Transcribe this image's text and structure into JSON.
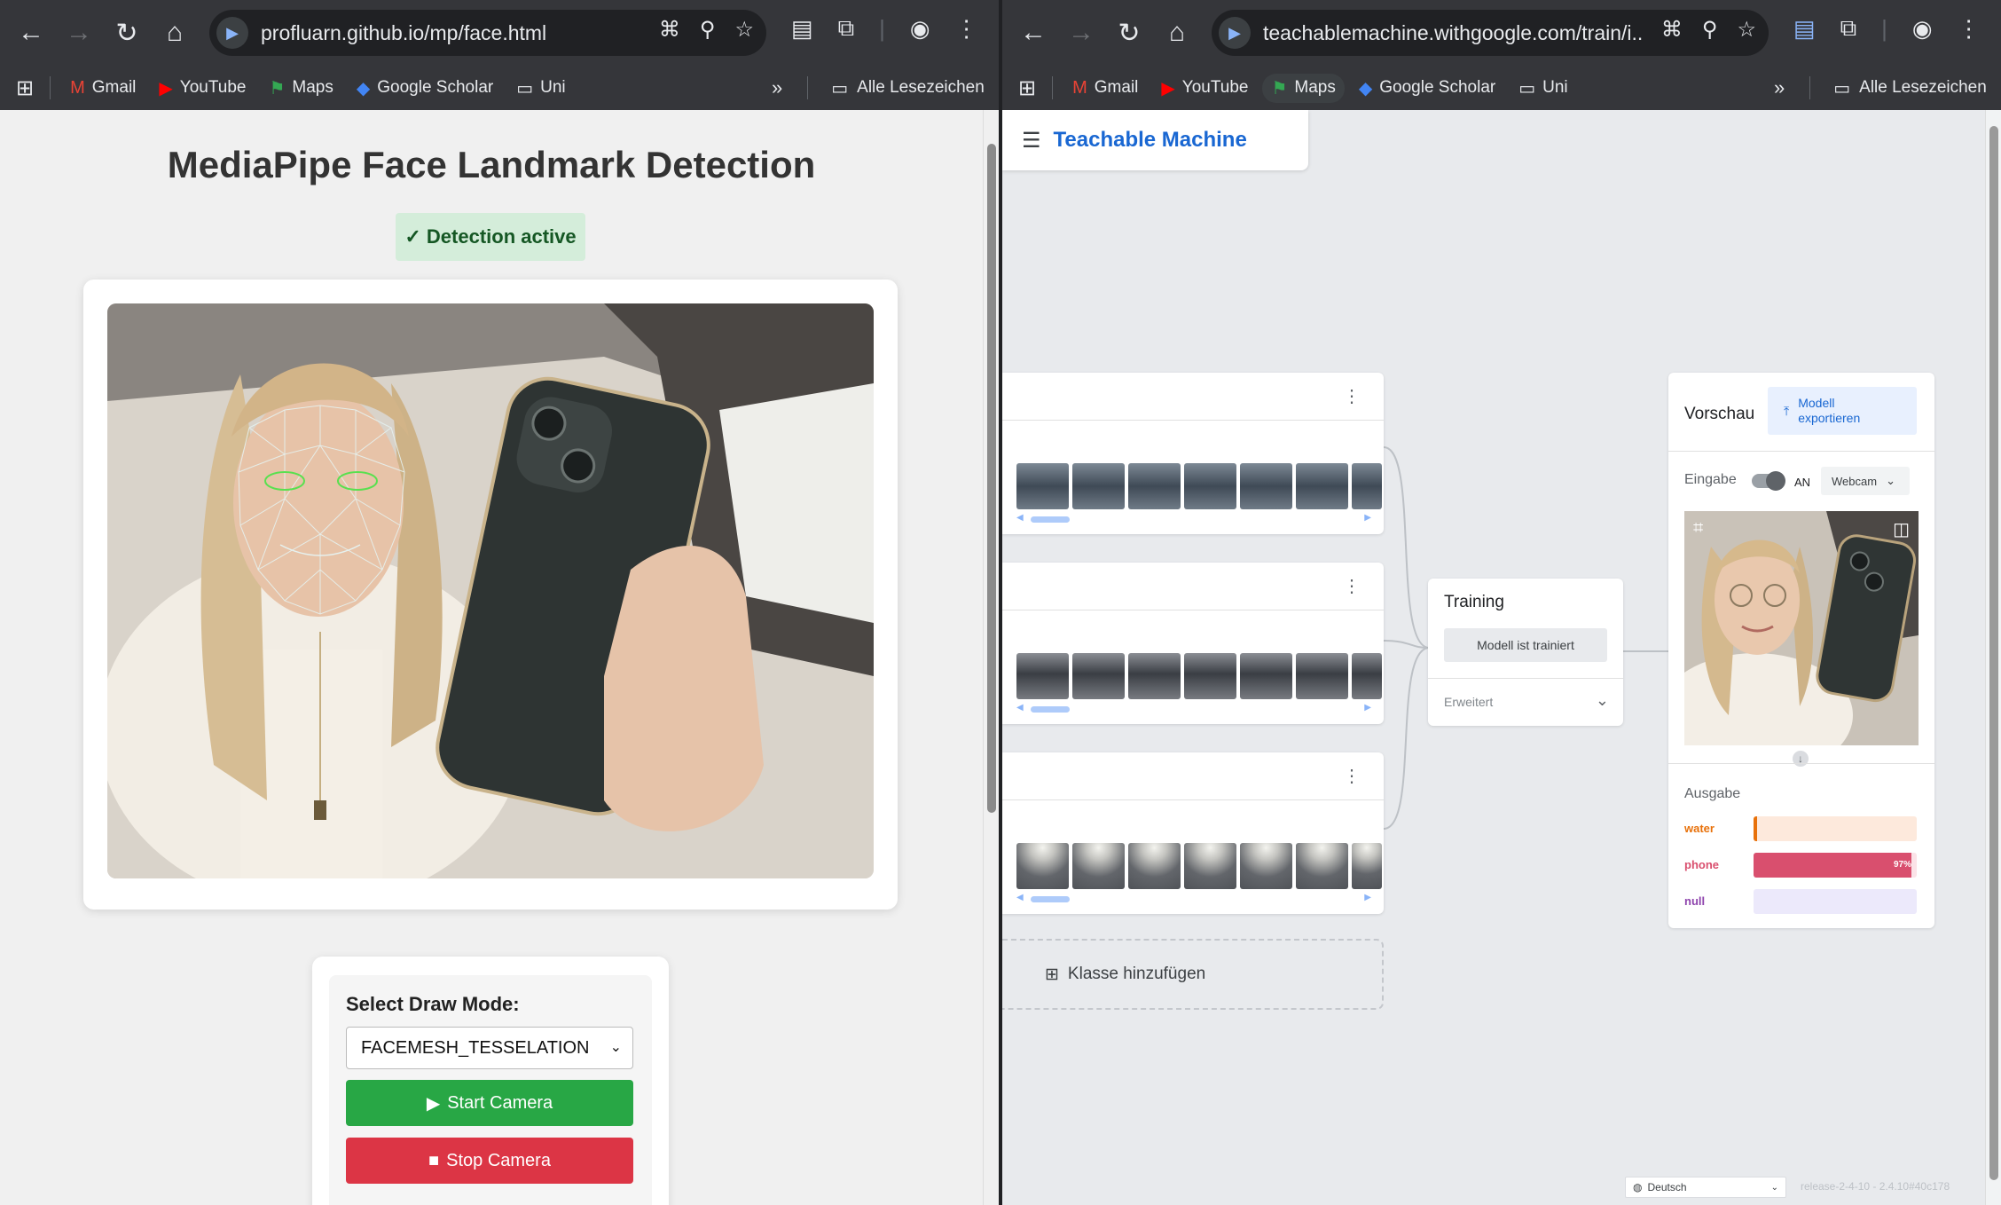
{
  "left": {
    "url": "profluarn.github.io/mp/face.html",
    "bookmarks": [
      {
        "label": "Gmail",
        "icon": "gmail-icon"
      },
      {
        "label": "YouTube",
        "icon": "youtube-icon"
      },
      {
        "label": "Maps",
        "icon": "maps-icon"
      },
      {
        "label": "Google Scholar",
        "icon": "scholar-icon"
      },
      {
        "label": "Uni",
        "icon": "folder-icon"
      }
    ],
    "all_bookmarks": "Alle Lesezeichen",
    "page": {
      "title": "MediaPipe Face Landmark Detection",
      "status": "✓ Detection active",
      "draw_mode_label": "Select Draw Mode:",
      "draw_mode_value": "FACEMESH_TESSELATION",
      "start_label": "Start Camera",
      "stop_label": "Stop Camera"
    }
  },
  "right": {
    "url": "teachablemachine.withgoogle.com/train/i...",
    "bookmarks": [
      {
        "label": "Gmail",
        "icon": "gmail-icon"
      },
      {
        "label": "YouTube",
        "icon": "youtube-icon"
      },
      {
        "label": "Maps",
        "icon": "maps-icon"
      },
      {
        "label": "Google Scholar",
        "icon": "scholar-icon"
      },
      {
        "label": "Uni",
        "icon": "folder-icon"
      }
    ],
    "all_bookmarks": "Alle Lesezeichen",
    "app": {
      "title": "Teachable Machine",
      "add_class": "Klasse hinzufügen",
      "training": {
        "title": "Training",
        "button": "Modell ist trainiert",
        "advanced": "Erweitert"
      },
      "preview": {
        "title": "Vorschau",
        "export": "Modell exportieren",
        "input_label": "Eingabe",
        "toggle_state": "AN",
        "source": "Webcam",
        "output_label": "Ausgabe",
        "outputs": [
          {
            "name": "water",
            "fraction": 0.02,
            "pct_text": "",
            "color": "#e8710a",
            "track": "#fde9dc"
          },
          {
            "name": "phone",
            "fraction": 0.97,
            "pct_text": "97%",
            "color": "#d94f6e",
            "track": "#fbe3e8"
          },
          {
            "name": "null",
            "fraction": 0.0,
            "pct_text": "",
            "color": "#8e44ad",
            "track": "#ece9fb"
          }
        ]
      },
      "language": "Deutsch",
      "release": "release-2-4-10 - 2.4.10#40c178"
    }
  }
}
